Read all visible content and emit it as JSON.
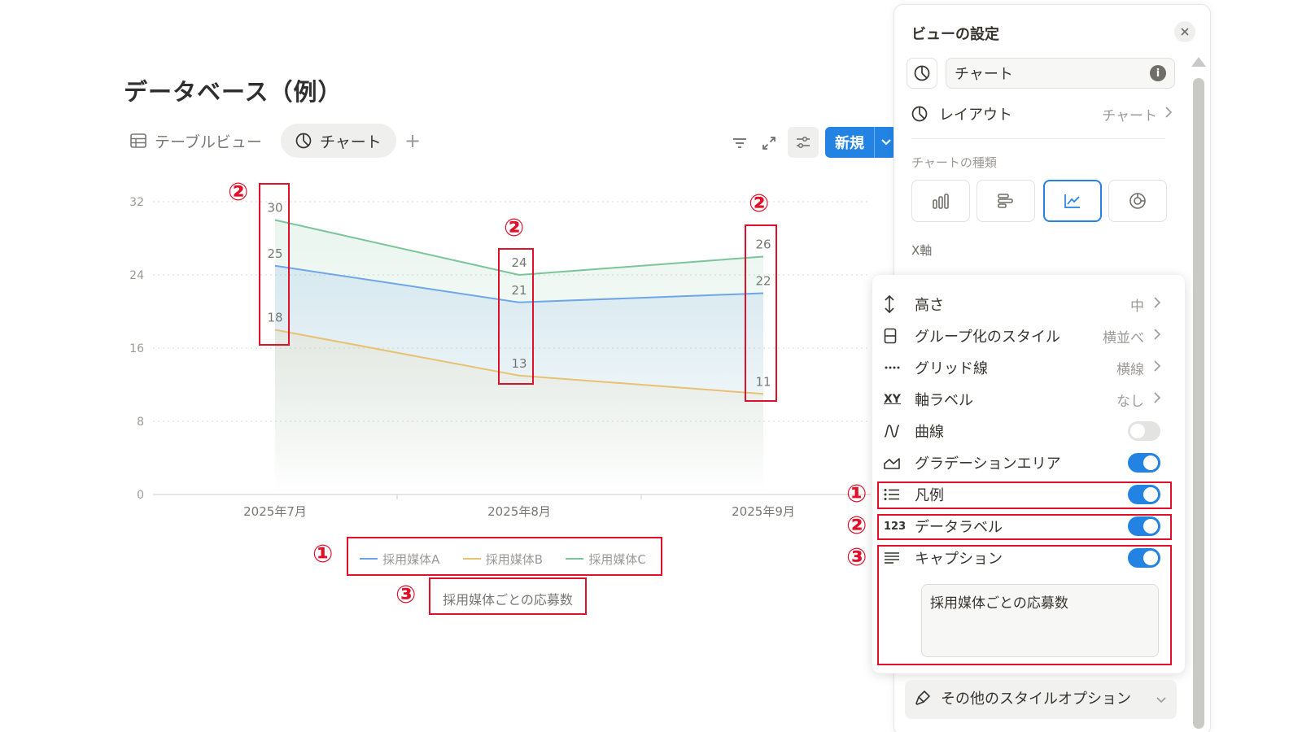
{
  "page": {
    "title": "データベース（例）"
  },
  "tabs": [
    {
      "label": "テーブルビュー",
      "icon": "table-icon",
      "active": false
    },
    {
      "label": "チャート",
      "icon": "chart-icon",
      "active": true
    }
  ],
  "tab_add": "+",
  "toolbar": {
    "new_label": "新規",
    "icons": [
      "filter-icon",
      "expand-icon",
      "settings-sliders-icon",
      "chevron-down-icon"
    ]
  },
  "chart_data": {
    "type": "area",
    "categories": [
      "2025年7月",
      "2025年8月",
      "2025年9月"
    ],
    "series": [
      {
        "name": "採用媒体A",
        "color": "#6fa6e8",
        "values": [
          25,
          21,
          22
        ]
      },
      {
        "name": "採用媒体B",
        "color": "#e8c173",
        "values": [
          18,
          13,
          11
        ]
      },
      {
        "name": "採用媒体C",
        "color": "#7cc49a",
        "values": [
          30,
          24,
          26
        ]
      }
    ],
    "yticks": [
      "0",
      "8",
      "16",
      "24",
      "32"
    ],
    "ylim": [
      0,
      32
    ],
    "grid": "horizontal",
    "data_labels": true,
    "legend": "bottom",
    "caption": "採用媒体ごとの応募数",
    "gradient_area": true
  },
  "annotations": {
    "markers": [
      "①",
      "②",
      "③"
    ],
    "color": "#e0102b"
  },
  "panel": {
    "title": "ビューの設定",
    "view_name": "チャート",
    "info": "i",
    "layout_label": "レイアウト",
    "layout_value": "チャート",
    "chart_types_label": "チャートの種類",
    "chart_type_icons": [
      "vertical-bar-icon",
      "horizontal-bar-icon",
      "line-chart-icon",
      "donut-chart-icon"
    ],
    "xaxis_label": "X軸"
  },
  "submenu": {
    "height": {
      "label": "高さ",
      "value": "中"
    },
    "group_style": {
      "label": "グループ化のスタイル",
      "value": "横並べ"
    },
    "grid": {
      "label": "グリッド線",
      "value": "横線"
    },
    "axis_labels": {
      "icon_text": "XY",
      "label": "軸ラベル",
      "value": "なし"
    },
    "smooth": {
      "label": "曲線",
      "on": false
    },
    "gradient": {
      "label": "グラデーションエリア",
      "on": true
    },
    "legend": {
      "label": "凡例",
      "on": true
    },
    "data_labels": {
      "icon_text": "123",
      "label": "データラベル",
      "on": true
    },
    "caption": {
      "label": "キャプション",
      "on": true,
      "value": "採用媒体ごとの応募数"
    }
  },
  "more_styles": "その他のスタイルオプション"
}
